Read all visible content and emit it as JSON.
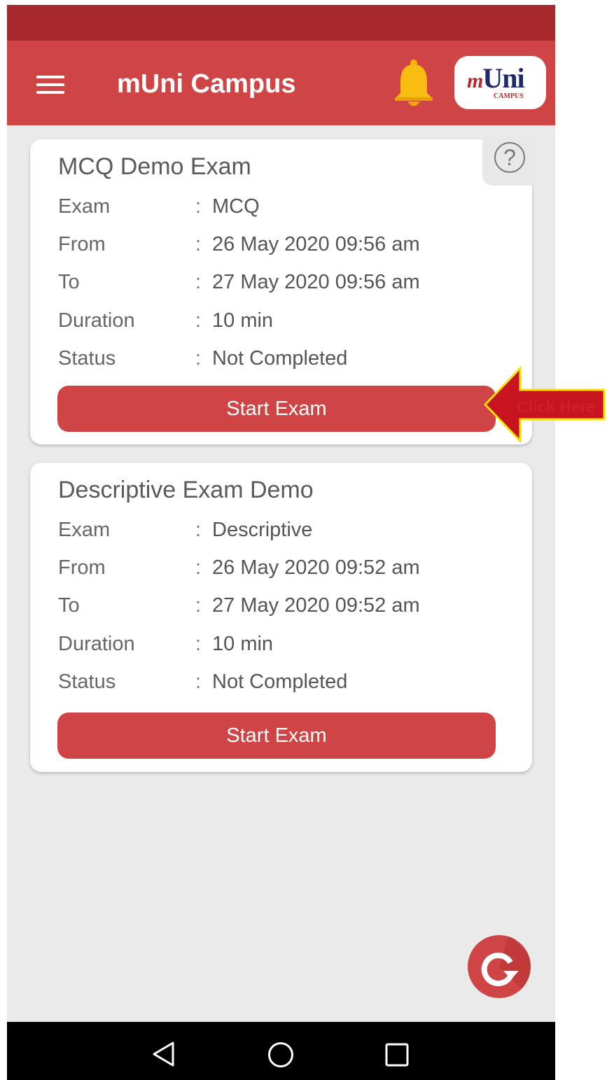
{
  "header": {
    "title": "mUni Campus",
    "logo_main": "Uni",
    "logo_prefix": "m",
    "logo_sub": "CAMPUS"
  },
  "exams": [
    {
      "title": "MCQ Demo Exam",
      "rows": [
        {
          "label": "Exam",
          "value": "MCQ"
        },
        {
          "label": "From",
          "value": "26 May 2020 09:56 am"
        },
        {
          "label": "To",
          "value": "27 May 2020 09:56 am"
        },
        {
          "label": "Duration",
          "value": "10 min"
        },
        {
          "label": "Status",
          "value": "Not Completed"
        }
      ],
      "button": "Start Exam"
    },
    {
      "title": "Descriptive Exam Demo",
      "rows": [
        {
          "label": "Exam",
          "value": "Descriptive"
        },
        {
          "label": "From",
          "value": "26 May 2020 09:52 am"
        },
        {
          "label": "To",
          "value": "27 May 2020 09:52 am"
        },
        {
          "label": "Duration",
          "value": "10 min"
        },
        {
          "label": "Status",
          "value": "Not Completed"
        }
      ],
      "button": "Start Exam"
    }
  ],
  "help_icon": "?",
  "callout": "Click Here",
  "colors": {
    "status_bar": "#a5292d",
    "app_bar": "#cf4545",
    "button": "#cf4545",
    "callout_fill": "#c8141e",
    "callout_border": "#f5e000"
  },
  "icons": [
    "menu-icon",
    "bell-icon",
    "help-icon",
    "refresh-icon",
    "back-icon",
    "home-icon",
    "recents-icon"
  ]
}
